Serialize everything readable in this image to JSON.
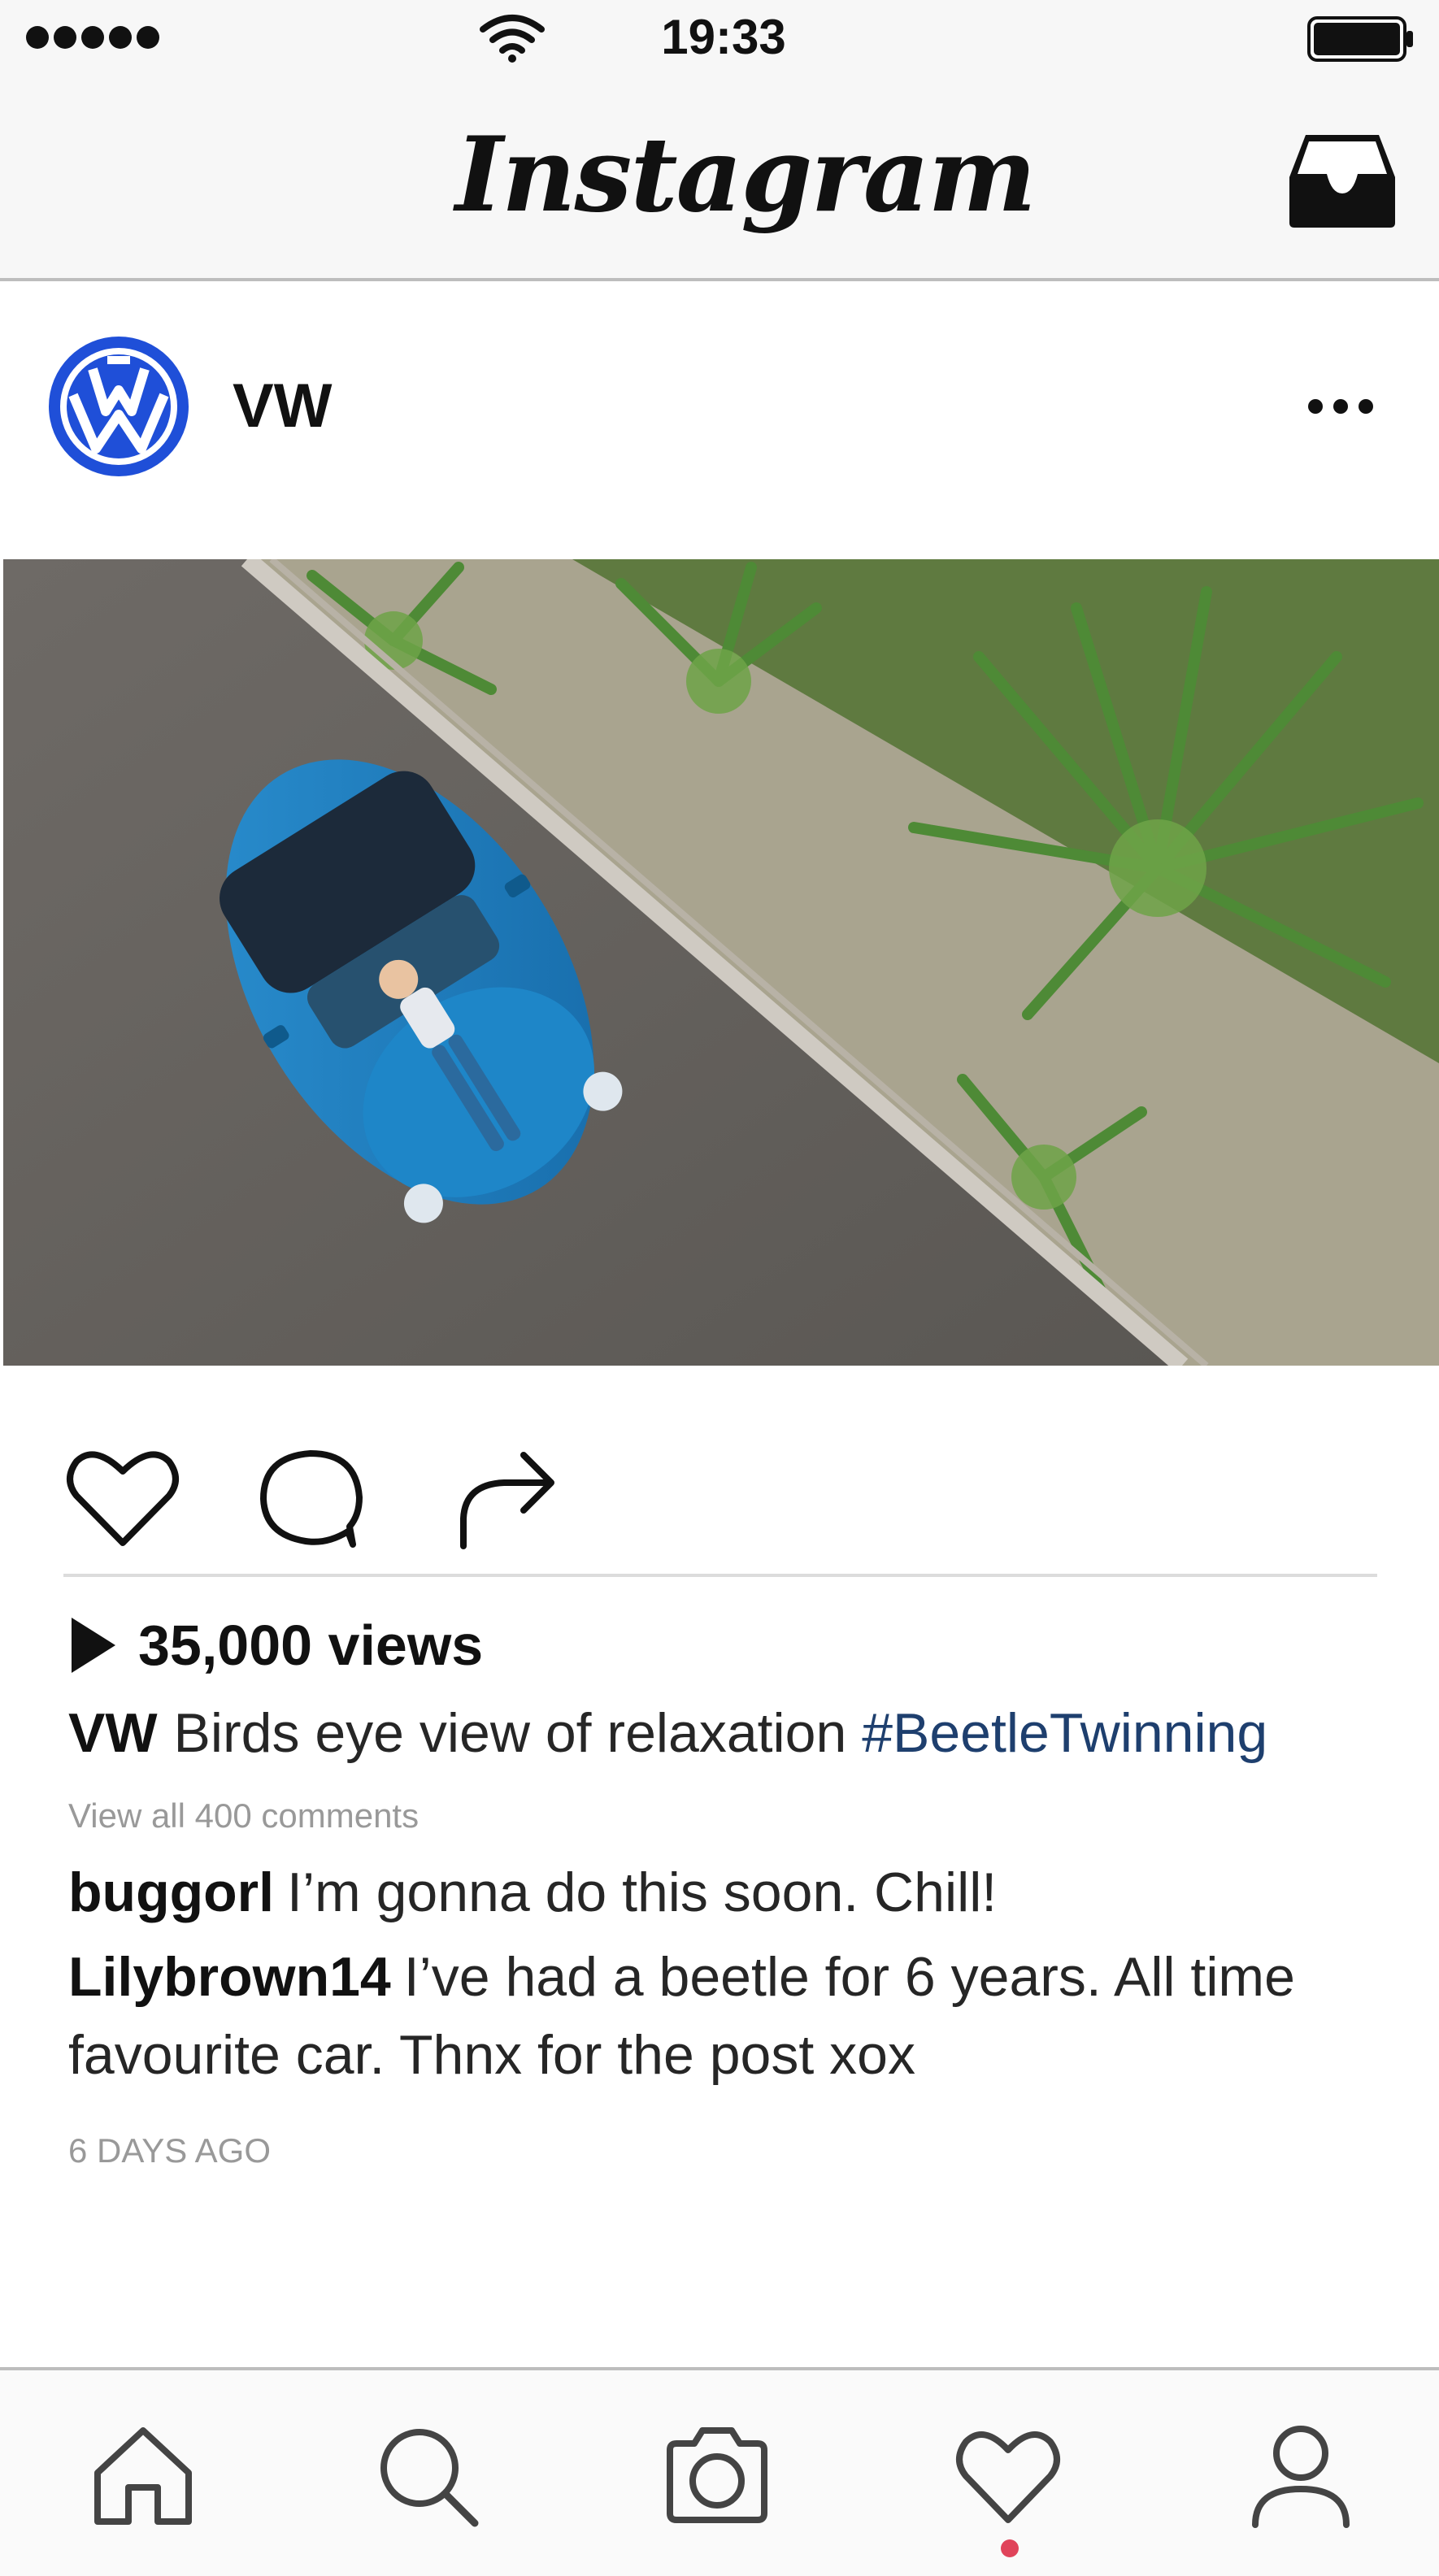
{
  "status_bar": {
    "time": "19:33",
    "signal_icon": "signal-dots-icon",
    "wifi_icon": "wifi-icon",
    "battery_icon": "battery-icon"
  },
  "nav_bar": {
    "logo_text": "Instagram",
    "inbox_icon": "inbox-tray-icon"
  },
  "post": {
    "account": "VW",
    "avatar_icon": "vw-logo",
    "more_icon": "more-dots-icon",
    "actions": {
      "like_icon": "heart-icon",
      "comment_icon": "comment-bubble-icon",
      "share_icon": "share-arrow-icon"
    },
    "views": "35,000 views",
    "caption": {
      "user": "VW",
      "text": "Birds eye view of relaxation",
      "hashtag": "#BeetleTwinning"
    },
    "view_all_comments": "View all  400 comments",
    "comments": [
      {
        "user": "buggorl",
        "text": "I’m gonna do this soon. Chill!"
      },
      {
        "user": "Lilybrown14",
        "text": "I’ve had a beetle for 6 years. All time favourite car. Thnx for the post xox"
      }
    ],
    "timestamp": "6 DAYS AGO"
  },
  "tab_bar": {
    "items": [
      {
        "icon": "home-icon"
      },
      {
        "icon": "search-icon"
      },
      {
        "icon": "camera-icon"
      },
      {
        "icon": "heart-icon",
        "notification": true
      },
      {
        "icon": "profile-icon"
      }
    ]
  },
  "colors": {
    "vw_blue": "#1f4fd8",
    "hashtag": "#1e3f6e",
    "notification_dot": "#e0435a",
    "car_blue": "#1b84c6"
  }
}
